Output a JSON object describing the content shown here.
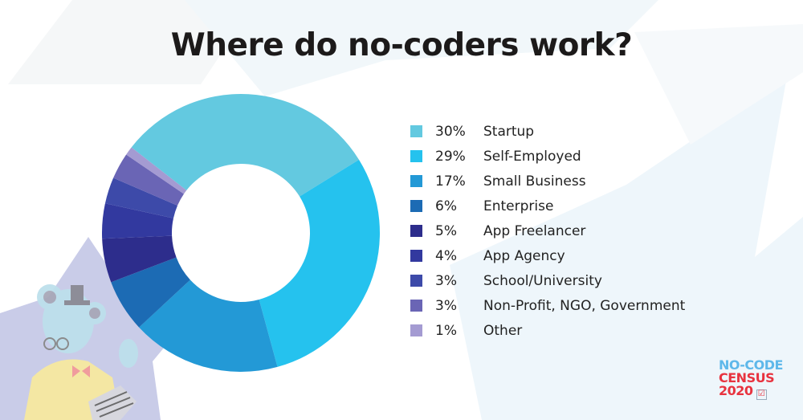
{
  "title": "Where do no-coders work?",
  "chart_data": {
    "type": "pie",
    "subtype": "donut",
    "title": "Where do no-coders work?",
    "slices": [
      {
        "label": "Startup",
        "value": 30,
        "display": "30%",
        "color": "#63c9e0"
      },
      {
        "label": "Self-Employed",
        "value": 29,
        "display": "29%",
        "color": "#25c2ee"
      },
      {
        "label": "Small Business",
        "value": 17,
        "display": "17%",
        "color": "#2399d6"
      },
      {
        "label": "Enterprise",
        "value": 6,
        "display": "6%",
        "color": "#1c6bb4"
      },
      {
        "label": "App Freelancer",
        "value": 5,
        "display": "5%",
        "color": "#2d2d8c"
      },
      {
        "label": "App Agency",
        "value": 4,
        "display": "4%",
        "color": "#32399f"
      },
      {
        "label": "School/University",
        "value": 3,
        "display": "3%",
        "color": "#3d4aa9"
      },
      {
        "label": "Non-Profit, NGO, Government",
        "value": 3,
        "display": "3%",
        "color": "#6a65b5"
      },
      {
        "label": "Other",
        "value": 1,
        "display": "1%",
        "color": "#a49bd2"
      }
    ],
    "legend_position": "right",
    "start_angle_deg": -52,
    "direction": "clockwise"
  },
  "logo": {
    "line1": "NO-CODE",
    "line2": "CENSUS",
    "line3": "2020",
    "check_icon": "☑"
  }
}
